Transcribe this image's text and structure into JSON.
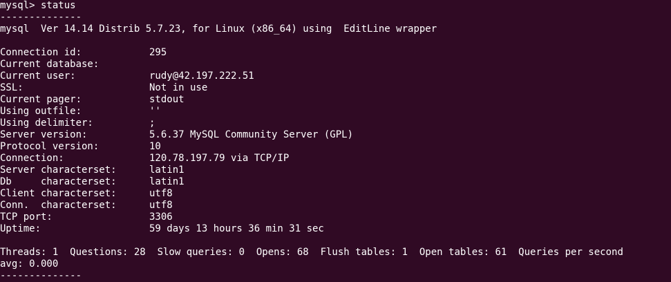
{
  "prompt_line": "mysql> status",
  "separator": "--------------",
  "version_line": "mysql  Ver 14.14 Distrib 5.7.23, for Linux (x86_64) using  EditLine wrapper",
  "status_rows": [
    {
      "key": "Connection id:",
      "value": "295"
    },
    {
      "key": "Current database:",
      "value": ""
    },
    {
      "key": "Current user:",
      "value": "rudy@42.197.222.51"
    },
    {
      "key": "SSL:",
      "value": "Not in use"
    },
    {
      "key": "Current pager:",
      "value": "stdout"
    },
    {
      "key": "Using outfile:",
      "value": "''"
    },
    {
      "key": "Using delimiter:",
      "value": ";"
    },
    {
      "key": "Server version:",
      "value": "5.6.37 MySQL Community Server (GPL)"
    },
    {
      "key": "Protocol version:",
      "value": "10"
    },
    {
      "key": "Connection:",
      "value": "120.78.197.79 via TCP/IP"
    },
    {
      "key": "Server characterset:",
      "value": "latin1"
    },
    {
      "key": "Db     characterset:",
      "value": "latin1"
    },
    {
      "key": "Client characterset:",
      "value": "utf8"
    },
    {
      "key": "Conn.  characterset:",
      "value": "utf8"
    },
    {
      "key": "TCP port:",
      "value": "3306"
    },
    {
      "key": "Uptime:",
      "value": "59 days 13 hours 36 min 31 sec"
    }
  ],
  "summary_line_1": "Threads: 1  Questions: 28  Slow queries: 0  Opens: 68  Flush tables: 1  Open tables: 61  Queries per second",
  "summary_line_2": "avg: 0.000",
  "separator_end": "--------------",
  "colors": {
    "background": "#300a24",
    "foreground": "#ffffff"
  }
}
